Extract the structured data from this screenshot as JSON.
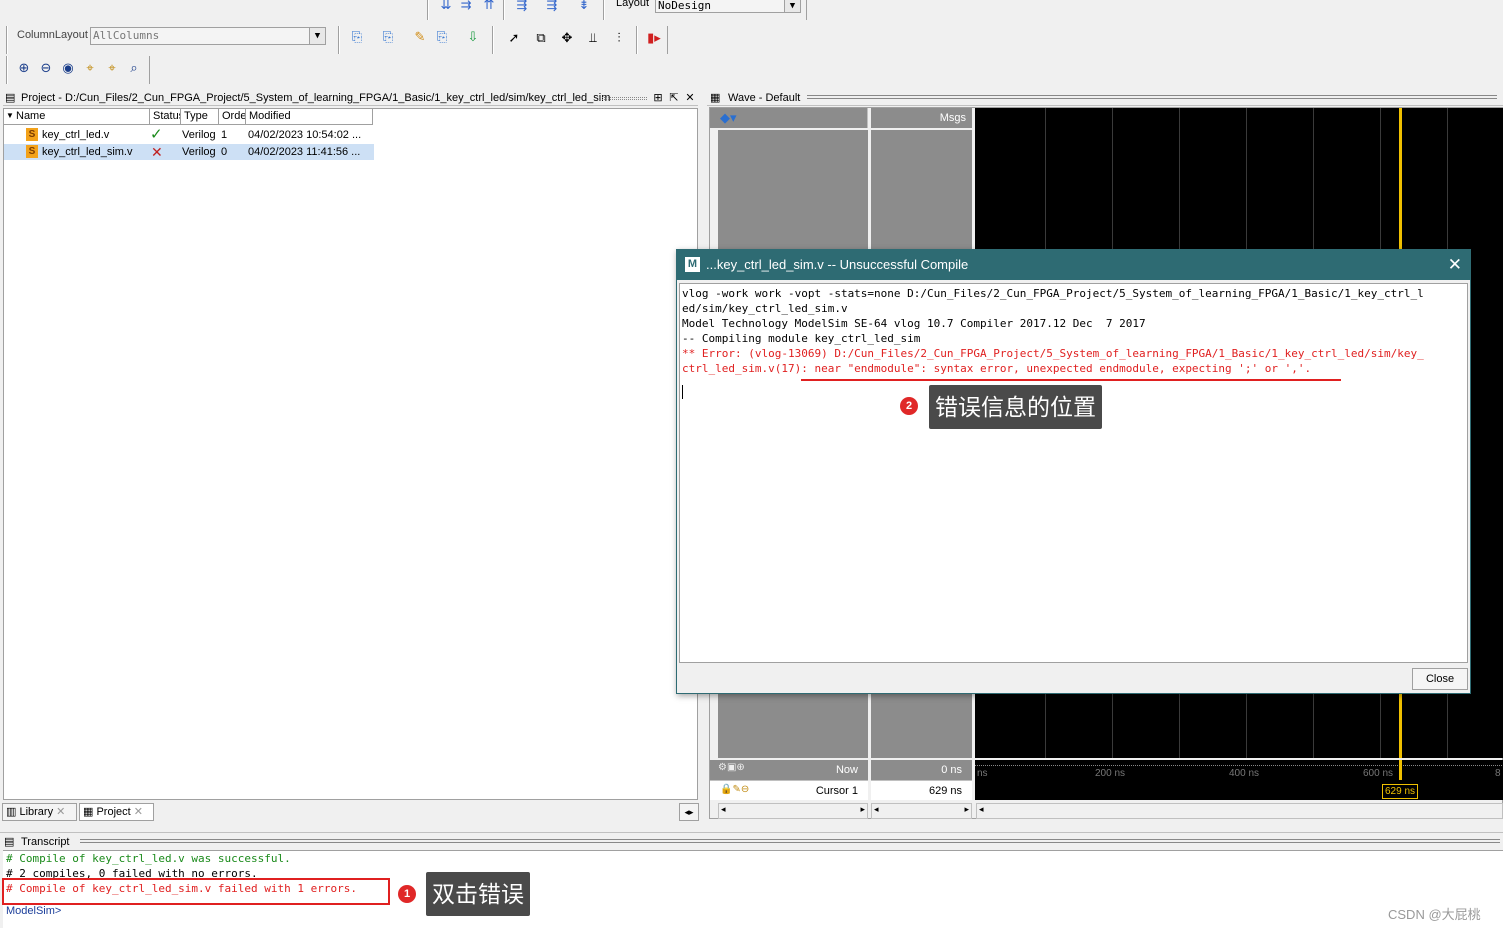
{
  "toolbar": {
    "layout_label": "Layout",
    "layout_value": "NoDesign",
    "column_layout_label": "ColumnLayout",
    "column_layout_value": "AllColumns"
  },
  "project_panel": {
    "title": "Project - D:/Cun_Files/2_Cun_FPGA_Project/5_System_of_learning_FPGA/1_Basic/1_key_ctrl_led/sim/key_ctrl_led_sim",
    "columns": [
      "Name",
      "Status",
      "Type",
      "Order",
      "Modified"
    ],
    "files": [
      {
        "name": "key_ctrl_led.v",
        "status": "ok",
        "type": "Verilog",
        "order": "1",
        "modified": "04/02/2023 10:54:02 ..."
      },
      {
        "name": "key_ctrl_led_sim.v",
        "status": "error",
        "type": "Verilog",
        "order": "0",
        "modified": "04/02/2023 11:41:56 ..."
      }
    ],
    "tabs": [
      "Library",
      "Project"
    ]
  },
  "wave_panel": {
    "title": "Wave - Default",
    "msgs_header": "Msgs",
    "now_label": "Now",
    "now_value": "0 ns",
    "cursor_label": "Cursor 1",
    "cursor_value": "629 ns",
    "cursor_marker": "629 ns",
    "timeline_ticks": [
      "ns",
      "200 ns",
      "400 ns",
      "600 ns",
      "8"
    ]
  },
  "dialog": {
    "title": "...key_ctrl_led_sim.v  -- Unsuccessful Compile",
    "lines": [
      {
        "text": "vlog -work work -vopt -stats=none D:/Cun_Files/2_Cun_FPGA_Project/5_System_of_learning_FPGA/1_Basic/1_key_ctrl_l",
        "error": false
      },
      {
        "text": "ed/sim/key_ctrl_led_sim.v",
        "error": false
      },
      {
        "text": "Model Technology ModelSim SE-64 vlog 10.7 Compiler 2017.12 Dec  7 2017",
        "error": false
      },
      {
        "text": "-- Compiling module key_ctrl_led_sim",
        "error": false
      },
      {
        "text": "** Error: (vlog-13069) D:/Cun_Files/2_Cun_FPGA_Project/5_System_of_learning_FPGA/1_Basic/1_key_ctrl_led/sim/key_",
        "error": true
      },
      {
        "text": "ctrl_led_sim.v(17): near \"endmodule\": syntax error, unexpected endmodule, expecting ';' or ','.",
        "error": true
      }
    ],
    "close_button": "Close",
    "close_icon": "close-icon"
  },
  "annotations": {
    "a1_number": "1",
    "a1_text": "双击错误",
    "a2_number": "2",
    "a2_text": "错误信息的位置"
  },
  "transcript": {
    "title": "Transcript",
    "lines": [
      {
        "text": "# Compile of key_ctrl_led.v was successful.",
        "kind": "ok"
      },
      {
        "text": "# 2 compiles, 0 failed with no errors.",
        "kind": "normal"
      },
      {
        "text": "# Compile of key_ctrl_led_sim.v failed with 1 errors.",
        "kind": "error"
      }
    ],
    "prompt": "ModelSim>"
  },
  "watermark": "CSDN @大屁桃",
  "colors": {
    "dialog_title_bg": "#2e6b73",
    "error_red": "#e02020",
    "cursor_yellow": "#f0c000",
    "annotation_bg": "#4a4a4a"
  }
}
